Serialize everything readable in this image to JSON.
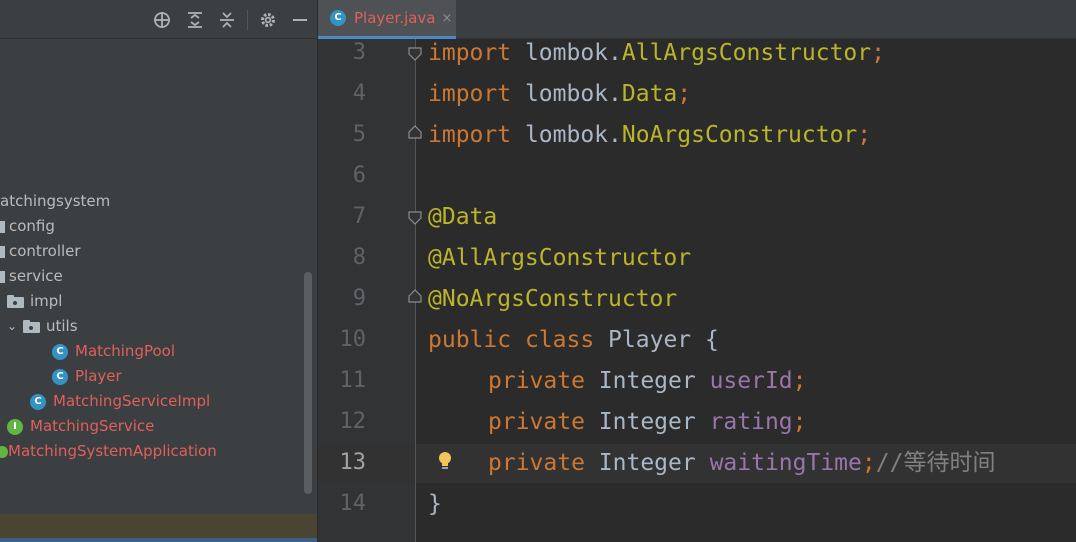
{
  "colors": {
    "panel_bg": "#3c3f41",
    "editor_bg": "#2b2b2b",
    "keyword": "#cc7832",
    "annotation": "#bbb529",
    "field": "#9876aa",
    "comment": "#808080",
    "error_file": "#e0605a"
  },
  "toolbar": {
    "icons": [
      "locate-icon",
      "expand-all-icon",
      "collapse-all-icon",
      "gear-icon",
      "minimize-icon"
    ]
  },
  "tree": {
    "root": "atchingsystem",
    "config": "config",
    "controller": "controller",
    "service": "service",
    "impl": "impl",
    "utils": "utils",
    "matching_pool": "MatchingPool",
    "player": "Player",
    "matching_service_impl": "MatchingServiceImpl",
    "matching_service": "MatchingService",
    "app": "MatchingSystemApplication",
    "class_badge": "C",
    "interface_badge": "I"
  },
  "tab": {
    "label": "Player.java",
    "close": "×",
    "badge": "C"
  },
  "lines": {
    "n3": "3",
    "n4": "4",
    "n5": "5",
    "n6": "6",
    "n7": "7",
    "n8": "8",
    "n9": "9",
    "n10": "10",
    "n11": "11",
    "n12": "12",
    "n13": "13",
    "n14": "14",
    "import": "import",
    "l3_pkg": " lombok.",
    "l3_cls": "AllArgsConstructor",
    "l4_cls": "Data",
    "l5_cls": "NoArgsConstructor",
    "semi": ";",
    "a7": "@Data",
    "a8": "@AllArgsConstructor",
    "a9": "@NoArgsConstructor",
    "public": "public",
    "class": "class",
    "player_decl": " Player {",
    "private": "private",
    "integer": " Integer ",
    "f_user": "userId",
    "f_rating": "rating",
    "f_wait": "waitingTime",
    "comment": "//等待时间",
    "close_brace": "}"
  }
}
